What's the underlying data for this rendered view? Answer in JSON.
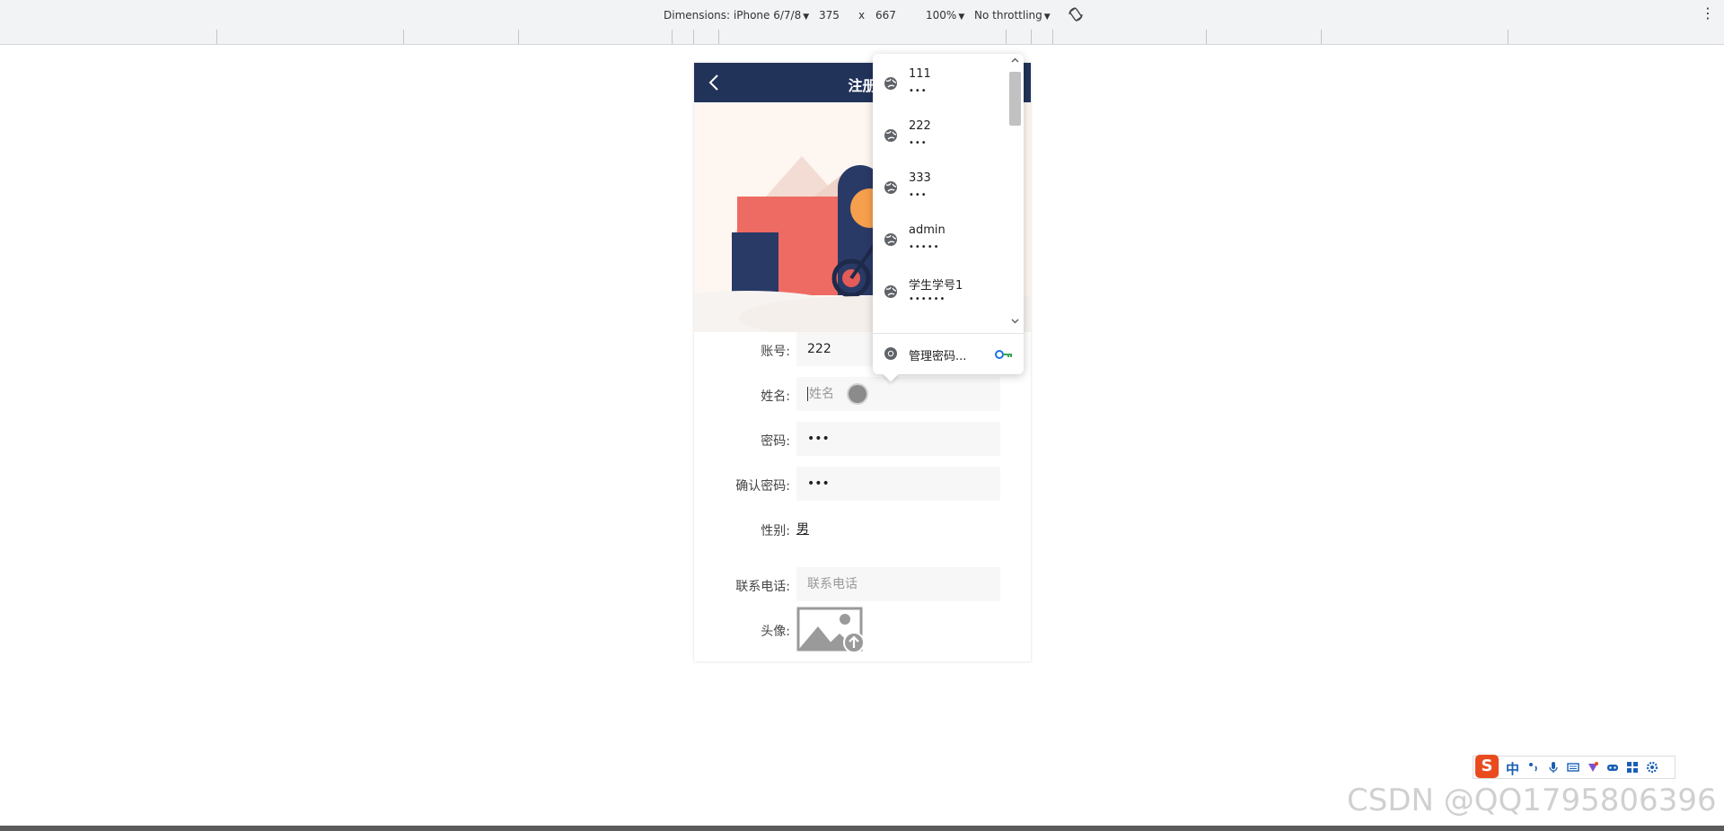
{
  "devtools": {
    "dimensions_label": "Dimensions: iPhone 6/7/8",
    "width": "375",
    "times": "x",
    "height": "667",
    "zoom": "100%",
    "throttling": "No throttling",
    "rotate_icon": "rotate-icon",
    "more_icon": "vertical-dots-icon"
  },
  "page": {
    "nav_title": "注册",
    "back_icon": "chevron-left-icon",
    "nav_color": "#22335a"
  },
  "form": {
    "account_label": "账号:",
    "account_value": "222",
    "name_label": "姓名:",
    "name_placeholder": "姓名",
    "password_label": "密码:",
    "password_value": "•••",
    "confirm_label": "确认密码:",
    "confirm_value": "•••",
    "gender_label": "性别:",
    "gender_value": "男",
    "phone_label": "联系电话:",
    "phone_placeholder": "联系电话",
    "avatar_label": "头像:",
    "avatar_icon": "image-upload-icon"
  },
  "autofill": {
    "items": [
      {
        "username": "111",
        "password": "•••"
      },
      {
        "username": "222",
        "password": "•••"
      },
      {
        "username": "333",
        "password": "•••"
      },
      {
        "username": "admin",
        "password": "•••••"
      },
      {
        "username": "学生学号1",
        "password": "••••••"
      }
    ],
    "manage_label": "管理密码...",
    "item_icon": "globe-icon",
    "manage_icon": "chrome-icon",
    "key_icon": "key-icon"
  },
  "ime": {
    "logo": "S",
    "mode": "中"
  },
  "watermark": "CSDN @QQ1795806396"
}
